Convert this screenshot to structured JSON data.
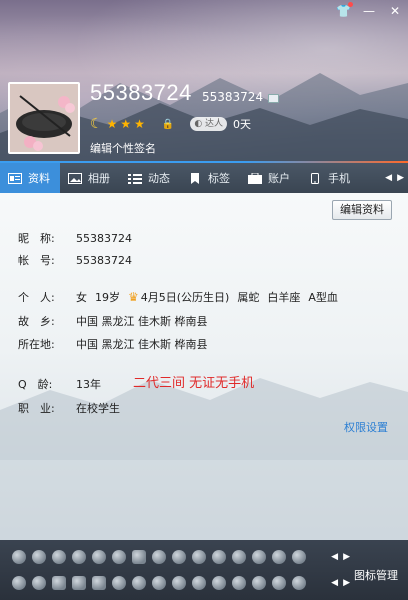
{
  "header": {
    "nickname": "55383724",
    "qq_number": "55383724",
    "days": "0天",
    "daren_label": "达人",
    "signature": "编辑个性签名",
    "star_count": 3,
    "top_icons": [
      "shirt-icon",
      "minimize-icon",
      "close-icon"
    ]
  },
  "tabs": [
    {
      "label": "资料",
      "icon": "profile-card-icon",
      "active": true
    },
    {
      "label": "相册",
      "icon": "photo-icon"
    },
    {
      "label": "动态",
      "icon": "feed-icon"
    },
    {
      "label": "标签",
      "icon": "bookmark-icon"
    },
    {
      "label": "账户",
      "icon": "wallet-icon"
    },
    {
      "label": "手机",
      "icon": "phone-icon"
    }
  ],
  "content": {
    "edit_button": "编辑资料",
    "nickname_label": "昵　称:",
    "nickname": "55383724",
    "account_label": "帐　号:",
    "account": "55383724",
    "personal_label": "个　人:",
    "gender": "女",
    "age": "19岁",
    "birthday": "4月5日(公历生日)",
    "zodiac": "属蛇",
    "constellation": "白羊座",
    "blood_type": "A型血",
    "hometown_label": "故　乡:",
    "hometown": "中国 黑龙江 佳木斯 桦南县",
    "location_label": "所在地:",
    "location": "中国 黑龙江 佳木斯 桦南县",
    "qage_label": "Q　龄:",
    "qage": "13年",
    "job_label": "职　业:",
    "job": "在校学生",
    "note": "二代三间 无证无手机",
    "permission_link": "权限设置"
  },
  "iconbar": {
    "manage_label": "图标管理"
  },
  "colors": {
    "tab_active": "#3c8fdb",
    "note_red": "#e02a2a",
    "link_blue": "#2c7fd3"
  }
}
